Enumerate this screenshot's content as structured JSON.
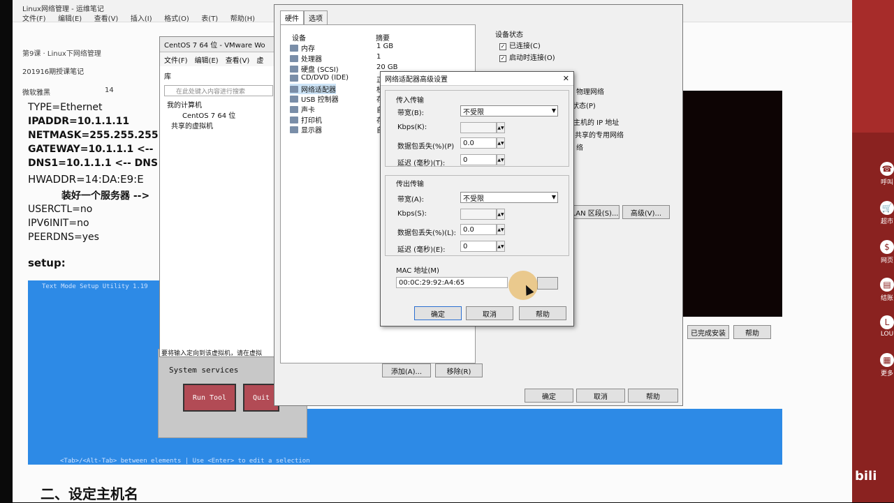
{
  "notes": {
    "app_title": "Linux网络管理 - 运维笔记",
    "menu": [
      "文件(F)",
      "编辑(E)",
      "查看(V)",
      "插入(I)",
      "格式(O)",
      "表(T)",
      "帮助(H)"
    ],
    "breadcrumb": "第9课 · Linux下网络管理",
    "notebook": "201916期授课笔记",
    "font_name": "微软雅黑",
    "font_size": "14",
    "lines": [
      "TYPE=Ethernet",
      "IPADDR=10.1.1.11",
      "NETMASK=255.255.255",
      "GATEWAY=10.1.1.1 <--",
      "DNS1=10.1.1.1 <-- DNS",
      "HWADDR=14:DA:E9:E",
      "装好一个服务器 -->",
      "USERCTL=no",
      "IPV6INIT=no",
      "PEERDNS=yes"
    ],
    "setup_heading": "setup:",
    "term_title": "Text Mode Setup Utility 1.19",
    "term_item": "System services",
    "term_run": "Run Tool",
    "term_quit": "Quit",
    "term_footer": "<Tab>/<Alt-Tab> between elements  |  Use <Enter> to edit a selection",
    "section_heading": "二、设定主机名"
  },
  "vmware": {
    "title": "CentOS 7 64 位 - VMware Wo",
    "menu": [
      "文件(F)",
      "编辑(E)",
      "查看(V)",
      "虚"
    ],
    "library_label": "库",
    "search_placeholder": "在此处键入内容进行搜索",
    "tree": [
      "我的计算机",
      "CentOS 7 64 位",
      "共享的虚拟机"
    ],
    "status_text": "要将输入定向到该虚拟机，请在虚拟"
  },
  "settings": {
    "tabs": [
      "硬件",
      "选项"
    ],
    "col_device": "设备",
    "col_summary": "摘要",
    "devices": [
      {
        "name": "内存",
        "summary": "1 GB"
      },
      {
        "name": "处理器",
        "summary": "1"
      },
      {
        "name": "硬盘 (SCSI)",
        "summary": "20 GB"
      },
      {
        "name": "CD/DVD (IDE)",
        "summary": "正"
      },
      {
        "name": "网络适配器",
        "summary": "桥"
      },
      {
        "name": "USB 控制器",
        "summary": "存"
      },
      {
        "name": "声卡",
        "summary": "自"
      },
      {
        "name": "打印机",
        "summary": "存"
      },
      {
        "name": "显示器",
        "summary": "自"
      }
    ],
    "device_status": "设备状态",
    "connected": "已连接(C)",
    "connect_on_start": "启动时连接(O)",
    "right_fragments": [
      "物理网络",
      "状态(P)",
      "主机的 IP 地址",
      "共享的专用网络",
      "络"
    ],
    "btn_segment": "LAN 区段(S)...",
    "btn_advanced": "高级(V)...",
    "btn_add": "添加(A)...",
    "btn_remove": "移除(R)",
    "btn_ok": "确定",
    "btn_cancel": "取消",
    "btn_help": "帮助",
    "btn_install_done": "已完成安装",
    "btn_help2": "帮助"
  },
  "advanced": {
    "title": "网络适配器高级设置",
    "incoming": "传入传输",
    "outgoing": "传出传输",
    "bandwidth_in_label": "带宽(B):",
    "bandwidth_in_value": "不受限",
    "kbps_in_label": "Kbps(K):",
    "loss_in_label": "数据包丢失(%)(P)",
    "loss_in_value": "0.0",
    "latency_in_label": "延迟 (毫秒)(T):",
    "latency_in_value": "0",
    "bandwidth_out_label": "带宽(A):",
    "bandwidth_out_value": "不受限",
    "kbps_out_label": "Kbps(S):",
    "loss_out_label": "数据包丢失(%)(L):",
    "loss_out_value": "0.0",
    "latency_out_label": "延迟 (毫秒)(E):",
    "latency_out_value": "0",
    "mac_label": "MAC 地址(M)",
    "mac_value": "00:0C:29:92:A4:65",
    "ok": "确定",
    "cancel": "取消",
    "help": "帮助"
  },
  "right_strip": {
    "items": [
      "呼叫",
      "超市",
      "网页",
      "结账",
      "LOU",
      "更多"
    ],
    "watermark": "bili"
  }
}
